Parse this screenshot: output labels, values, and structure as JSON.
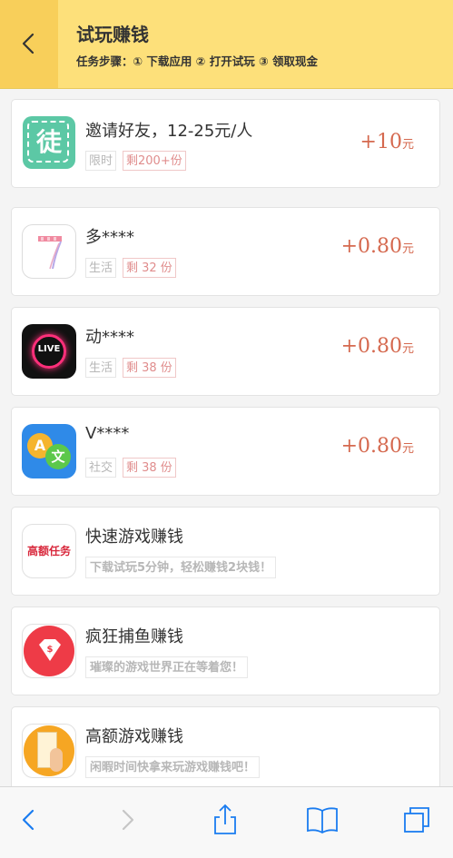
{
  "header": {
    "title": "试玩赚钱",
    "steps": "任务步骤：① 下载应用 ② 打开试玩 ③ 领取现金"
  },
  "invite": {
    "icon_char": "徒",
    "name": "邀请好友，12-25元/人",
    "tag1": "限时",
    "tag2": "剩200+份",
    "reward_num": "+10",
    "reward_unit": "元"
  },
  "tasks": [
    {
      "name": "多****",
      "category": "生活",
      "remaining": "剩 32 份",
      "reward_num": "+0.80",
      "reward_unit": "元",
      "icon": "seven-icon"
    },
    {
      "name": "动****",
      "category": "生活",
      "remaining": "剩 38 份",
      "reward_num": "+0.80",
      "reward_unit": "元",
      "icon": "live-icon",
      "icon_text": "LIVE"
    },
    {
      "name": "V****",
      "category": "社交",
      "remaining": "剩 38 份",
      "reward_num": "+0.80",
      "reward_unit": "元",
      "icon": "translate-icon",
      "icon_a": "A",
      "icon_b": "文"
    }
  ],
  "promos": [
    {
      "name": "快速游戏赚钱",
      "desc": "下载试玩5分钟，轻松赚钱2块钱！",
      "icon": "high-task-icon",
      "icon_text": "高额任务"
    },
    {
      "name": "疯狂捕鱼赚钱",
      "desc": "璀璨的游戏世界正在等着您！",
      "icon": "diamond-icon"
    },
    {
      "name": "高额游戏赚钱",
      "desc": "闲暇时间快拿来玩游戏赚钱吧！",
      "icon": "finger-icon"
    }
  ],
  "colors": {
    "header_bg": "#fde07a",
    "back_bg": "#f8cf5a",
    "reward": "#d5694f",
    "ios_blue": "#1a7cf0"
  }
}
